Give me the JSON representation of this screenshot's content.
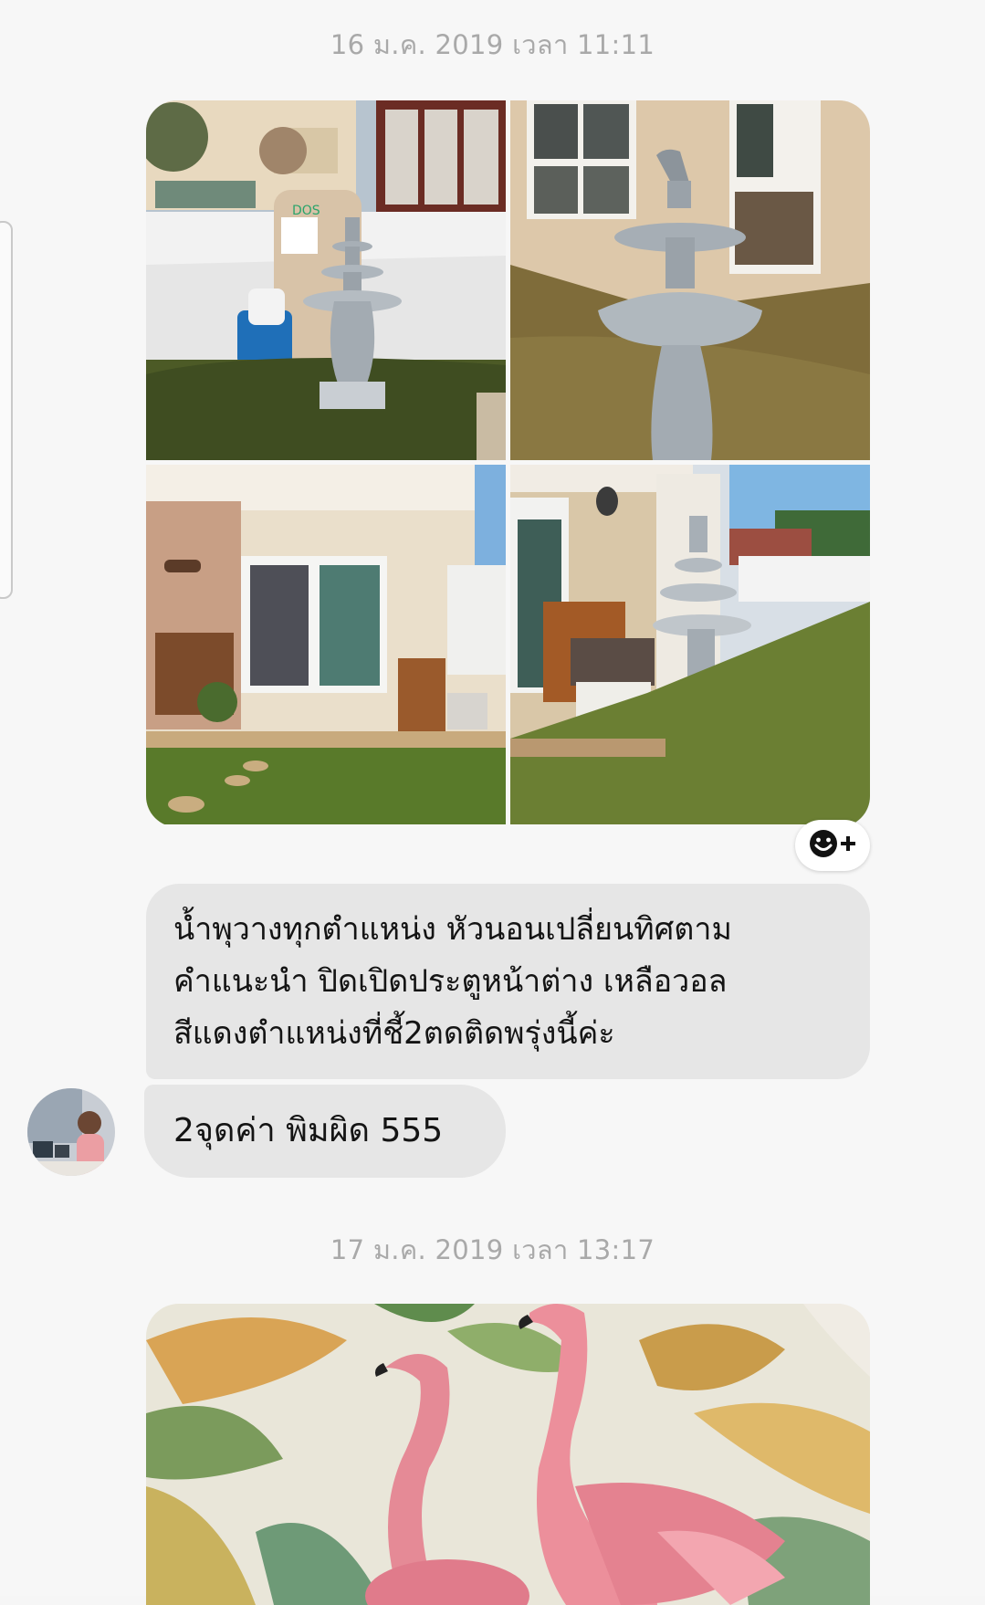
{
  "conversation": {
    "timestamp_1": "16 ม.ค. 2019 เวลา 11:11",
    "timestamp_2": "17 ม.ค. 2019 เวลา 13:17",
    "photos": [
      {
        "icon": "photo-fountain-yard"
      },
      {
        "icon": "photo-horse-fountain"
      },
      {
        "icon": "photo-house-front"
      },
      {
        "icon": "photo-house-side"
      }
    ],
    "react_button": {
      "icon": "smiley-plus-icon"
    },
    "message_1": {
      "lines": [
        "น้ำพุวางทุกตำแหน่ง หัวนอนเปลี่ยนทิศตาม",
        "คำแนะนำ ปิดเปิดประตูหน้าต่าง  เหลือวอล",
        "สีแดงตำแหน่งที่ชี้2ตดติดพรุ่งนี้ค่ะ"
      ]
    },
    "message_2": {
      "text": "2จุดค่า  พิมผิด 555"
    },
    "flamingo_image": {
      "icon": "flamingo-painting"
    }
  },
  "colors": {
    "background": "#f7f7f7",
    "bubble": "#e6e6e6",
    "timestamp": "#a9a9a9"
  }
}
